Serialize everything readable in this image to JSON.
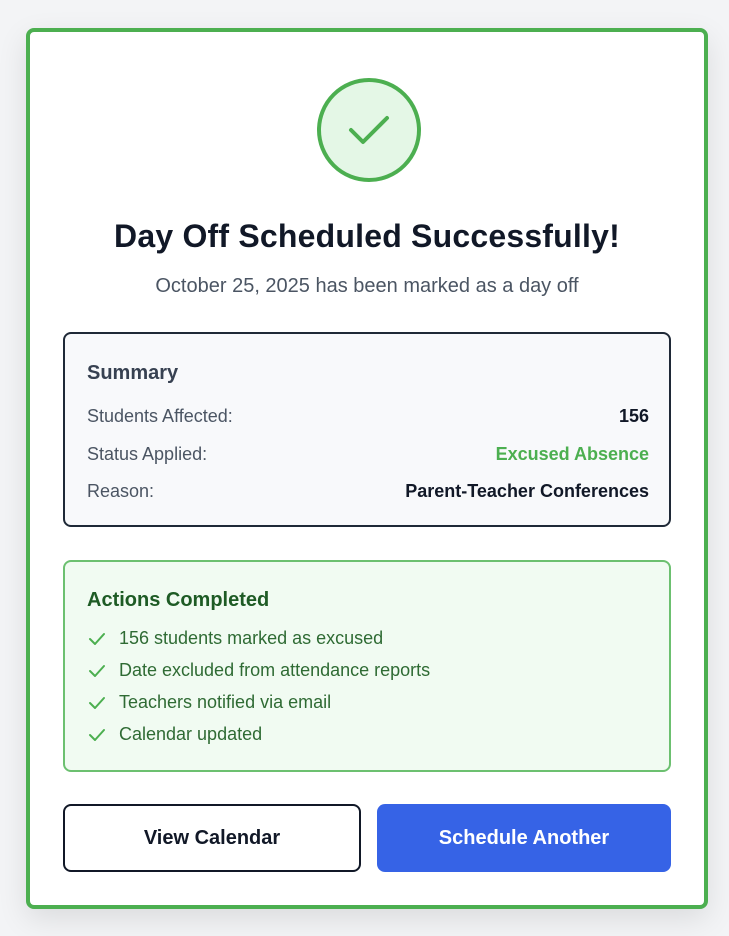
{
  "colors": {
    "success": "#4caf50",
    "success_light": "#e4f7e6",
    "primary": "#3663e6",
    "text_dark": "#111827"
  },
  "header": {
    "icon": "check-icon",
    "title": "Day Off Scheduled Successfully!",
    "subtitle": "October 25, 2025 has been marked as a day off"
  },
  "summary": {
    "title": "Summary",
    "rows": [
      {
        "label": "Students Affected:",
        "value": "156"
      },
      {
        "label": "Status Applied:",
        "value": "Excused Absence"
      },
      {
        "label": "Reason:",
        "value": "Parent-Teacher Conferences"
      }
    ]
  },
  "actions": {
    "title": "Actions Completed",
    "items": [
      "156 students marked as excused",
      "Date excluded from attendance reports",
      "Teachers notified via email",
      "Calendar updated"
    ]
  },
  "buttons": {
    "view_calendar": "View Calendar",
    "schedule_another": "Schedule Another"
  }
}
